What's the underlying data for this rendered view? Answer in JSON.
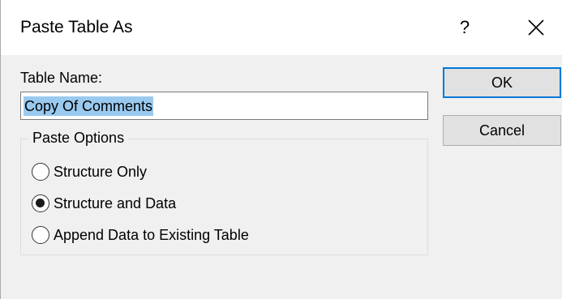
{
  "window": {
    "title": "Paste Table As",
    "help_label": "?",
    "close_icon": "close-icon"
  },
  "form": {
    "table_name_label": "Table Name:",
    "table_name_value": "Copy Of Comments"
  },
  "paste_options": {
    "legend": "Paste Options",
    "options": [
      {
        "label": "Structure Only",
        "checked": false
      },
      {
        "label": "Structure and Data",
        "checked": true
      },
      {
        "label": "Append Data to Existing Table",
        "checked": false
      }
    ]
  },
  "buttons": {
    "ok_label": "OK",
    "cancel_label": "Cancel"
  },
  "colors": {
    "accent": "#0078d7",
    "selection": "#99c9ef",
    "dialog_bg": "#f0f0f0"
  }
}
